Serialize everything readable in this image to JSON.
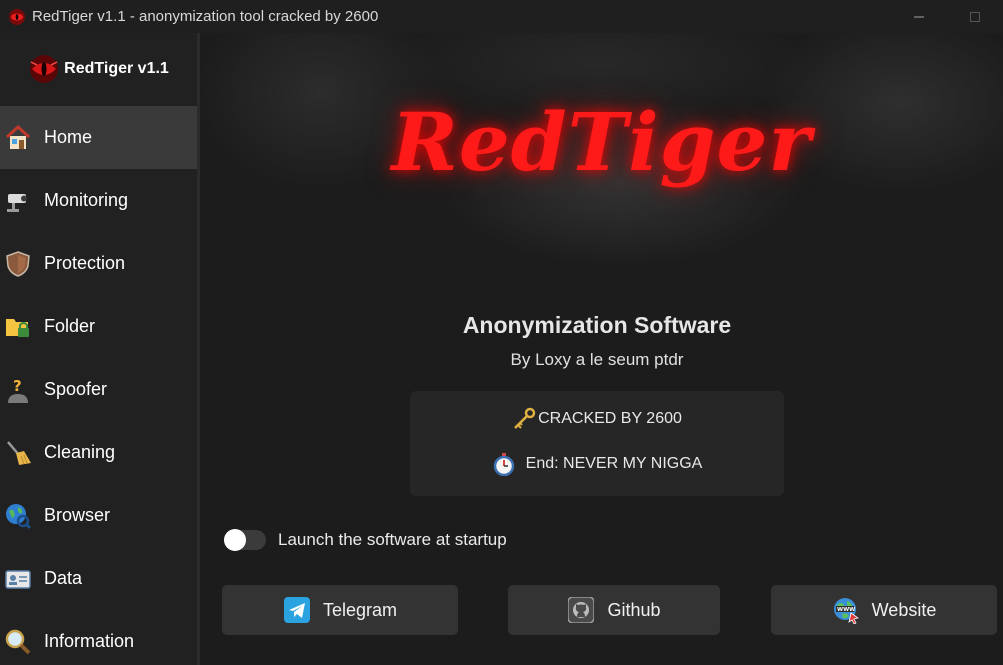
{
  "window": {
    "title": "RedTiger v1.1 - anonymization tool cracked by 2600",
    "icon": "tiger-eye-icon",
    "controls": [
      "minimize",
      "maximize"
    ]
  },
  "sidebar": {
    "brand": {
      "name": "RedTiger v1.1",
      "icon": "tiger-eye-icon"
    },
    "items": [
      {
        "label": "Home",
        "icon": "house-icon",
        "active": true
      },
      {
        "label": "Monitoring",
        "icon": "security-camera-icon",
        "active": false
      },
      {
        "label": "Protection",
        "icon": "shield-icon",
        "active": false
      },
      {
        "label": "Folder",
        "icon": "locked-folder-icon",
        "active": false
      },
      {
        "label": "Spoofer",
        "icon": "anonymous-user-icon",
        "active": false
      },
      {
        "label": "Cleaning",
        "icon": "broom-icon",
        "active": false
      },
      {
        "label": "Browser",
        "icon": "globe-search-icon",
        "active": false
      },
      {
        "label": "Data",
        "icon": "id-card-icon",
        "active": false
      },
      {
        "label": "Information",
        "icon": "magnifier-icon",
        "active": false
      }
    ]
  },
  "main": {
    "logo_text": "RedTiger",
    "headline": "Anonymization Software",
    "byline": "By Loxy a le seum ptdr",
    "info": {
      "line1": "CRACKED BY 2600",
      "line1_icon": "key-icon",
      "line2": "End: NEVER MY NIGGA",
      "line2_icon": "stopwatch-icon"
    },
    "startup": {
      "label": "Launch the software at startup",
      "enabled": false
    },
    "buttons": {
      "telegram": "Telegram",
      "github": "Github",
      "website": "Website"
    }
  },
  "colors": {
    "accent_red": "#ff1a1a",
    "sidebar_bg": "#212121",
    "active_item_bg": "#3a3a3a",
    "button_bg": "#333333"
  }
}
